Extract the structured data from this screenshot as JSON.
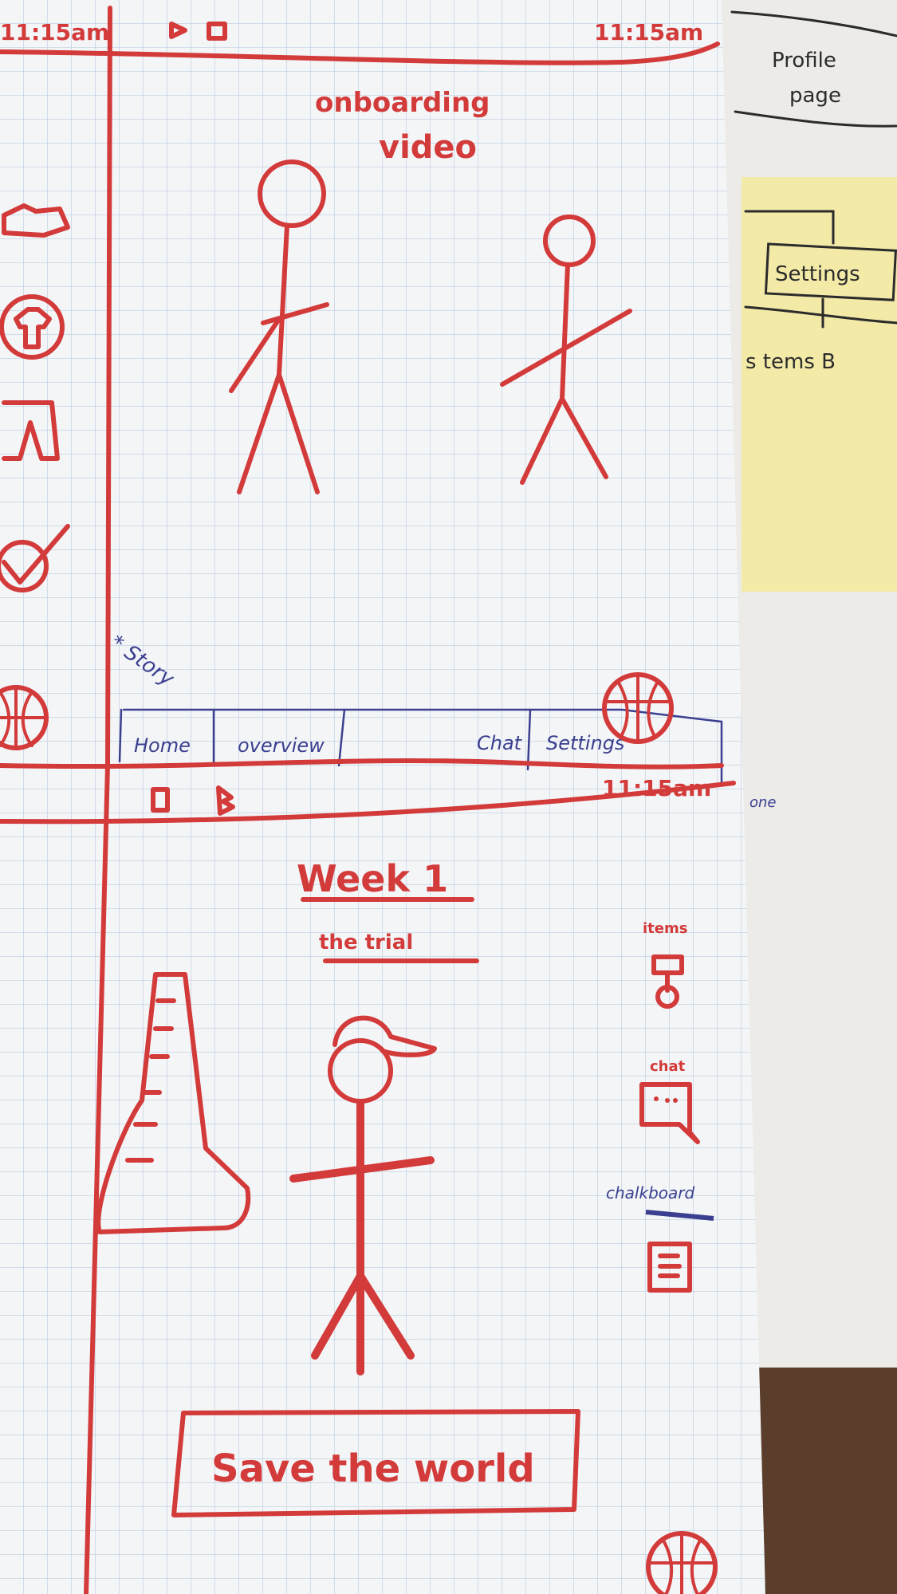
{
  "colors": {
    "ink_red": "#d33a3a",
    "ink_blue": "#3a3f8f",
    "paper": "#f4f5f7",
    "grid": "#b9cde0",
    "sticky": "#f3eaa8",
    "wood": "#5a3e2b"
  },
  "left_screen": {
    "time": "11:15am"
  },
  "onboarding_screen": {
    "status_time": "11:15am",
    "title_line1": "onboarding",
    "title_line2": "video",
    "annotation": "* Story",
    "nav_tabs": [
      "Home",
      "overview",
      "Chat",
      "Settings"
    ]
  },
  "week_screen": {
    "status_time": "11:15am",
    "title": "Week 1",
    "subtitle": "the trial",
    "side_icons": [
      {
        "label": "items",
        "icon": "items-icon"
      },
      {
        "label": "chat",
        "icon": "chat-icon"
      },
      {
        "label": "chalkboard",
        "icon": "chalkboard-icon"
      }
    ],
    "cta_label": "Save the world"
  },
  "side_paper": {
    "title_line1": "Profile",
    "title_line2": "page",
    "sticky_box": "Settings",
    "sticky_text": "s  tems  B",
    "margin_note": "one"
  }
}
